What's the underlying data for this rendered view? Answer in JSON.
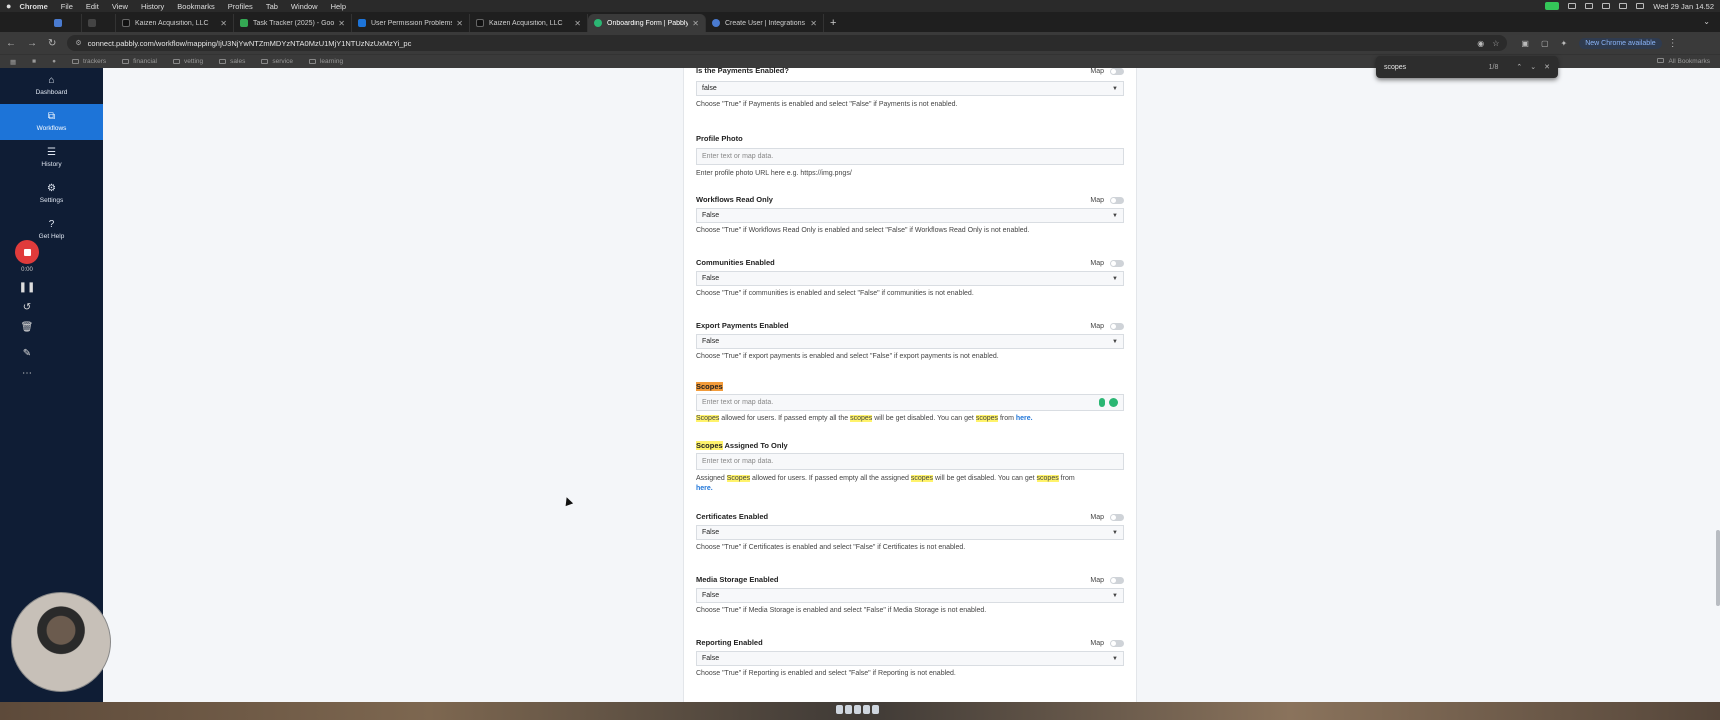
{
  "menubar": {
    "items": [
      "Chrome",
      "File",
      "Edit",
      "View",
      "History",
      "Bookmarks",
      "Profiles",
      "Tab",
      "Window",
      "Help"
    ],
    "clock": "Wed 29 Jan 14.52"
  },
  "tabs": [
    {
      "label": "",
      "color": "#4a7bd0"
    },
    {
      "label": "",
      "color": "#444444"
    },
    {
      "label": "Kaizen Acquisition, LLC",
      "color": "#111111"
    },
    {
      "label": "Task Tracker (2025) - Google",
      "color": "#34a853"
    },
    {
      "label": "User Permission Problems |",
      "color": "#1d74d8"
    },
    {
      "label": "Kaizen Acquisition, LLC",
      "color": "#111111"
    },
    {
      "label": "Onboarding Form | Pabbly Co",
      "color": "#2bb673"
    },
    {
      "label": "Create User | Integrations API",
      "color": "#4a7bd0"
    }
  ],
  "address": {
    "url": "connect.pabbly.com/workflow/mapping/IjU3NjYwNTZmMDYzNTA0MzU1MjY1NTUzNzUxMzYi_pc",
    "update_label": "New Chrome available"
  },
  "bookmarks": {
    "items": [
      "trackers",
      "financial",
      "vetting",
      "sales",
      "service",
      "learning"
    ],
    "all_label": "All Bookmarks"
  },
  "find": {
    "query": "scopes",
    "count": "1/8"
  },
  "sidebar": {
    "items": [
      {
        "label": "Dashboard",
        "icon": "home-icon"
      },
      {
        "label": "Workflows",
        "icon": "workflow-icon"
      },
      {
        "label": "History",
        "icon": "list-icon"
      },
      {
        "label": "Settings",
        "icon": "gear-icon"
      },
      {
        "label": "Get Help",
        "icon": "help-icon"
      }
    ]
  },
  "recorder": {
    "time": "0:00"
  },
  "form": {
    "map_label": "Map",
    "input_placeholder": "Enter text or map data.",
    "payments": {
      "label": "Is the Payments Enabled?",
      "value": "false",
      "help": "Choose \"True\" if Payments is enabled and select \"False\" if Payments is not enabled."
    },
    "profile_photo": {
      "label": "Profile Photo",
      "help": "Enter profile photo URL here e.g. https://img.pngs/"
    },
    "workflows_read_only": {
      "label": "Workflows Read Only",
      "value": "False",
      "help": "Choose \"True\" if Workflows Read Only is enabled and select \"False\" if Workflows Read Only is not enabled."
    },
    "communities": {
      "label": "Communities Enabled",
      "value": "False",
      "help": "Choose \"True\" if communities is enabled and select \"False\" if communities is not enabled."
    },
    "export_payments": {
      "label": "Export Payments Enabled",
      "value": "False",
      "help": "Choose \"True\" if export payments is enabled and select \"False\" if export payments is not enabled."
    },
    "scopes": {
      "label": "Scopes",
      "help_1": "Scopes",
      "help_2": " allowed for users. If passed empty all the ",
      "help_3": "scopes",
      "help_4": " will be get disabled. You can get ",
      "help_5": "scopes",
      "help_6": " from ",
      "link": "here."
    },
    "scopes_assigned": {
      "label_hl": "Scopes",
      "label_rest": " Assigned To Only",
      "help_1": "Assigned ",
      "help_2": "Scopes",
      "help_3": " allowed for users. If passed empty all the assigned ",
      "help_4": "scopes",
      "help_5": " will be get disabled. You can get ",
      "help_6": "scopes",
      "help_7": " from",
      "link": "here."
    },
    "certificates": {
      "label": "Certificates Enabled",
      "value": "False",
      "help": "Choose \"True\" if Certificates is enabled and select \"False\" if Certificates is not enabled."
    },
    "media_storage": {
      "label": "Media Storage Enabled",
      "value": "False",
      "help": "Choose \"True\" if Media Storage is enabled and select \"False\" if Media Storage is not enabled."
    },
    "reporting": {
      "label": "Reporting Enabled",
      "value": "False",
      "help": "Choose \"True\" if Reporting is enabled and select \"False\" if Reporting is not enabled."
    }
  }
}
